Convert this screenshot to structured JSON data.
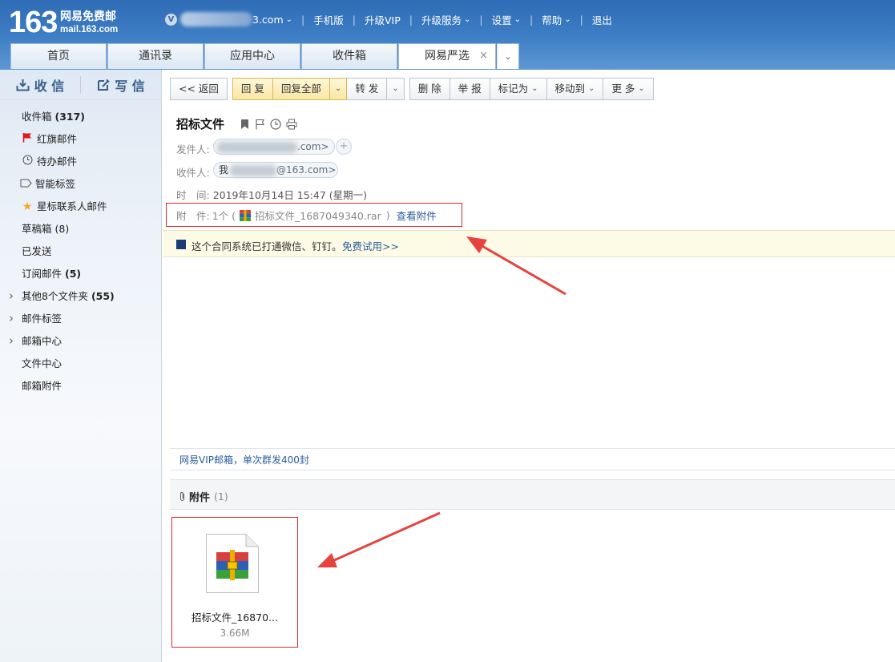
{
  "header": {
    "logo_num": "163",
    "logo_cn": "网易免费邮",
    "logo_url": "mail.163.com",
    "account_suffix": "3.com",
    "nav": [
      "手机版",
      "升级VIP",
      "升级服务",
      "设置",
      "帮助",
      "退出"
    ]
  },
  "tabs": [
    "首页",
    "通讯录",
    "应用中心",
    "收件箱",
    "网易严选"
  ],
  "sidebar": {
    "receive": "收 信",
    "compose": "写 信",
    "folders": [
      {
        "label": "收件箱",
        "count": "(317)"
      },
      {
        "label": "红旗邮件",
        "count": ""
      },
      {
        "label": "待办邮件",
        "count": ""
      },
      {
        "label": "智能标签",
        "count": ""
      },
      {
        "label": "星标联系人邮件",
        "count": ""
      },
      {
        "label": "草稿箱",
        "count": "(8)"
      },
      {
        "label": "已发送",
        "count": ""
      },
      {
        "label": "订阅邮件",
        "count": "(5)"
      },
      {
        "label": "其他8个文件夹",
        "count": "(55)"
      },
      {
        "label": "邮件标签",
        "count": ""
      },
      {
        "label": "邮箱中心",
        "count": ""
      },
      {
        "label": "文件中心",
        "count": ""
      },
      {
        "label": "邮箱附件",
        "count": ""
      }
    ]
  },
  "toolbar": {
    "back": "<< 返回",
    "reply": "回 复",
    "reply_all": "回复全部",
    "forward": "转 发",
    "delete": "删 除",
    "report": "举 报",
    "mark_as": "标记为",
    "move_to": "移动到",
    "more": "更 多"
  },
  "mail": {
    "subject": "招标文件",
    "from_label": "发件人:",
    "from_value": ".com>",
    "to_label": "收件人:",
    "to_prefix": "我",
    "to_value": "@163.com>",
    "time_label": "时　间:",
    "time_value": "2019年10月14日 15:47 (星期一)",
    "attach_label": "附　件:",
    "attach_count": "1个 (",
    "attach_name": "招标文件_1687049340.rar",
    "attach_close": ")",
    "view_attach": "查看附件"
  },
  "banner": {
    "text": "这个合同系统已打通微信、钉钉。",
    "link": "免费试用>>"
  },
  "vip_bar": "网易VIP邮箱，单次群发400封",
  "attachments": {
    "title": "附件",
    "count": "(1)",
    "file_name": "招标文件_16870...",
    "file_size": "3.66M"
  }
}
